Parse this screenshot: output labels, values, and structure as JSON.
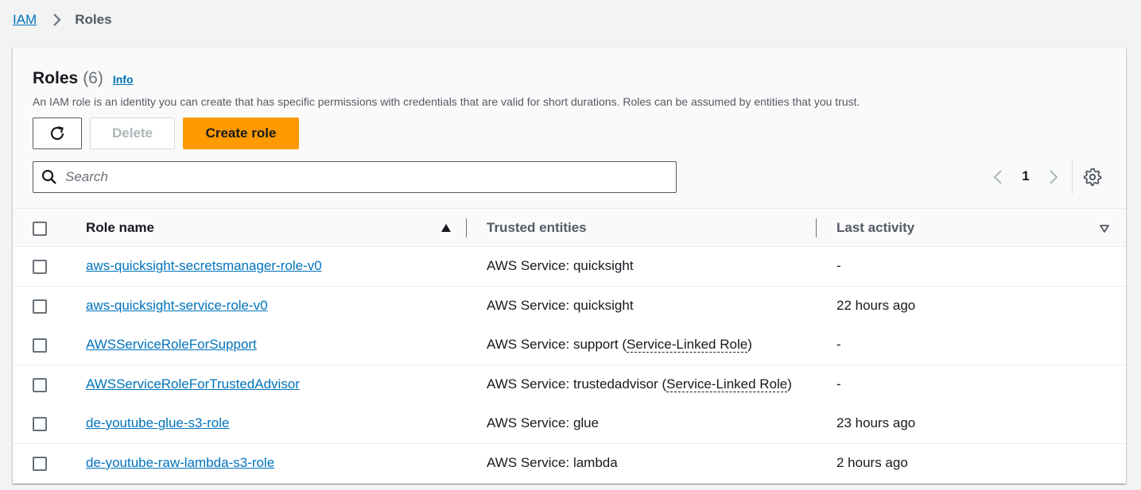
{
  "breadcrumb": {
    "root": "IAM",
    "current": "Roles"
  },
  "panel": {
    "title": "Roles",
    "count": "(6)",
    "info": "Info",
    "description": "An IAM role is an identity you can create that has specific permissions with credentials that are valid for short durations. Roles can be assumed by entities that you trust."
  },
  "toolbar": {
    "delete_label": "Delete",
    "create_label": "Create role"
  },
  "search": {
    "placeholder": "Search",
    "value": ""
  },
  "pagination": {
    "page": "1"
  },
  "table": {
    "columns": [
      "Role name",
      "Trusted entities",
      "Last activity"
    ],
    "rows": [
      {
        "name": "aws-quicksight-secretsmanager-role-v0",
        "trust": "AWS Service: quicksight",
        "trust_suffix": "",
        "activity": "-"
      },
      {
        "name": "aws-quicksight-service-role-v0",
        "trust": "AWS Service: quicksight",
        "trust_suffix": "",
        "activity": "22 hours ago"
      },
      {
        "name": "AWSServiceRoleForSupport",
        "trust": "AWS Service: support",
        "trust_suffix": "Service-Linked Role",
        "activity": "-"
      },
      {
        "name": "AWSServiceRoleForTrustedAdvisor",
        "trust": "AWS Service: trustedadvisor",
        "trust_suffix": "Service-Linked Role",
        "activity": "-"
      },
      {
        "name": "de-youtube-glue-s3-role",
        "trust": "AWS Service: glue",
        "trust_suffix": "",
        "activity": "23 hours ago"
      },
      {
        "name": "de-youtube-raw-lambda-s3-role",
        "trust": "AWS Service: lambda",
        "trust_suffix": "",
        "activity": "2 hours ago"
      }
    ]
  },
  "colors": {
    "link": "#0073bb",
    "primary_button": "#ff9900",
    "background": "#f2f3f3"
  },
  "icons": [
    "chevron-right-icon",
    "refresh-icon",
    "search-icon",
    "chevron-left-icon",
    "gear-icon",
    "sort-ascending-icon",
    "sort-descending-icon"
  ]
}
